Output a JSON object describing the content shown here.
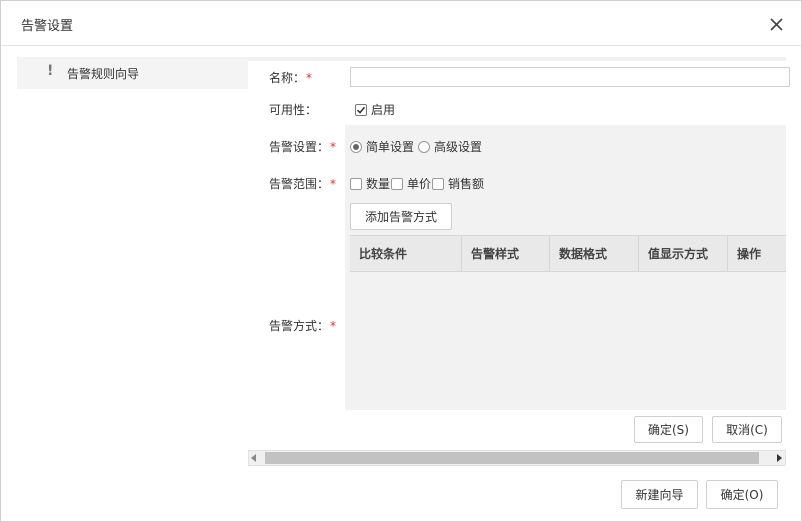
{
  "dialog": {
    "title": "告警设置"
  },
  "sidebar": {
    "items": [
      {
        "label": "告警规则向导"
      }
    ]
  },
  "form": {
    "name_label": "名称：",
    "name_value": "",
    "availability_label": "可用性：",
    "enabled_label": "启用",
    "enabled_checked": true,
    "alert_setting_label": "告警设置：",
    "simple_setting_label": "简单设置",
    "advanced_setting_label": "高级设置",
    "selected_setting": "简单设置",
    "scope_label": "告警范围：",
    "scope_options": [
      {
        "label": "数量",
        "checked": false
      },
      {
        "label": "单价",
        "checked": false
      },
      {
        "label": "销售额",
        "checked": false
      }
    ],
    "add_method_button": "添加告警方式",
    "method_label": "告警方式：",
    "required_mark": "*"
  },
  "method_table": {
    "columns": [
      "比较条件",
      "告警样式",
      "数据格式",
      "值显示方式",
      "操作"
    ],
    "rows": []
  },
  "inner_buttons": {
    "confirm": "确定(S)",
    "cancel": "取消(C)"
  },
  "footer": {
    "new_wizard": "新建向导",
    "confirm": "确定(O)"
  }
}
